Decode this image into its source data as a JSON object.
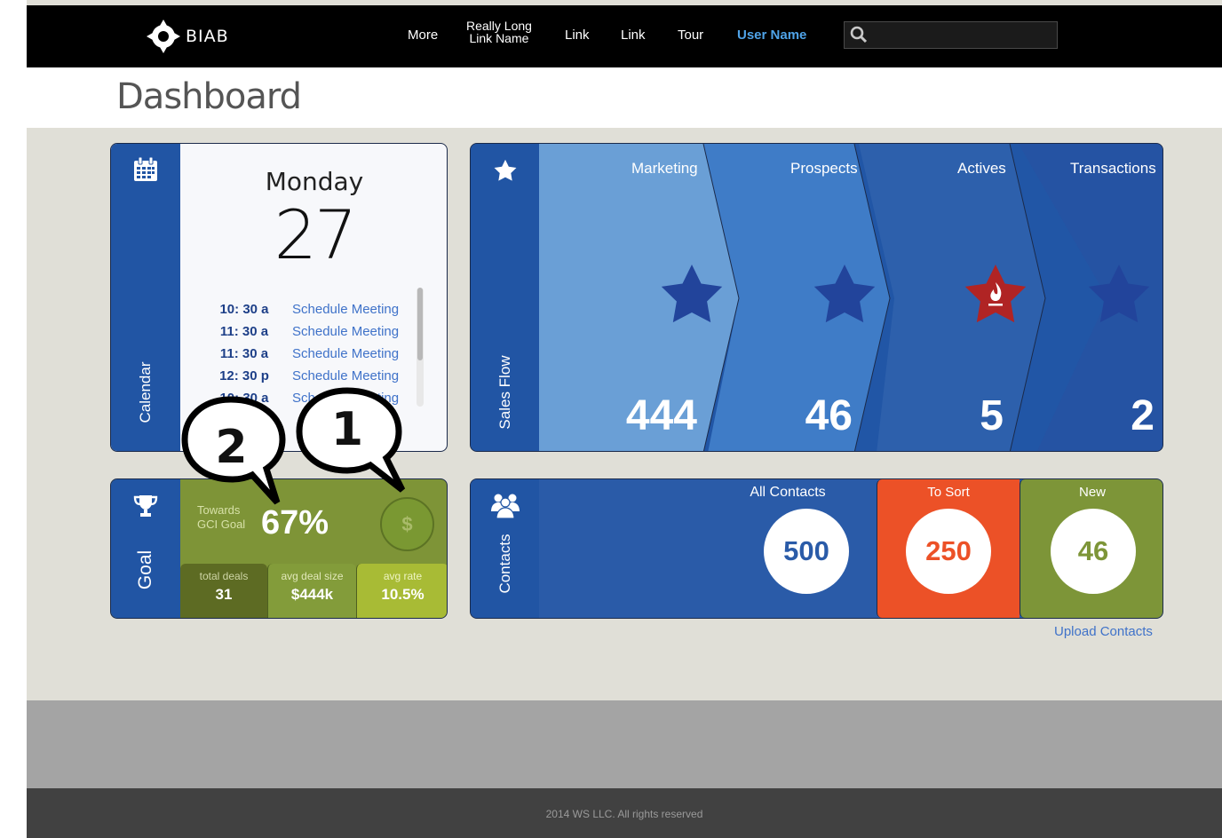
{
  "brand": {
    "name": "BIAB"
  },
  "nav": {
    "more": "More",
    "long_link_line1": "Really Long",
    "long_link_line2": "Link Name",
    "link1": "Link",
    "link2": "Link",
    "tour": "Tour",
    "user": "User Name"
  },
  "search": {
    "placeholder": "",
    "value": ""
  },
  "page": {
    "title": "Dashboard"
  },
  "calendar": {
    "label": "Calendar",
    "icon": "calendar-icon",
    "weekday": "Monday",
    "date": "27",
    "events": [
      {
        "time": "10: 30 a",
        "title": "Schedule Meeting"
      },
      {
        "time": "11: 30 a",
        "title": "Schedule Meeting"
      },
      {
        "time": "11: 30 a",
        "title": "Schedule Meeting"
      },
      {
        "time": "12: 30 p",
        "title": "Schedule Meeting"
      },
      {
        "time": "10: 30 a",
        "title": "Schedule Meeting"
      }
    ]
  },
  "sales_flow": {
    "label": "Sales Flow",
    "icon": "star-icon",
    "stages": [
      {
        "name": "Marketing",
        "count": "444",
        "color": "#6a9fd6"
      },
      {
        "name": "Prospects",
        "count": "46",
        "color": "#3f7cc7"
      },
      {
        "name": "Actives",
        "count": "5",
        "color": "#2d60ac"
      },
      {
        "name": "Transactions",
        "count": "2",
        "color": "#2553a3"
      }
    ],
    "star_color": "#22449b",
    "active_star_color": "#b02424"
  },
  "goal": {
    "label": "Goal",
    "icon": "trophy-icon",
    "towards_line1": "Towards",
    "towards_line2": "GCI Goal",
    "percent": "67%",
    "dollar": "$",
    "metrics": [
      {
        "label": "total deals",
        "value": "31"
      },
      {
        "label": "avg deal size",
        "value": "$444k"
      },
      {
        "label": "avg rate",
        "value": "10.5%"
      }
    ]
  },
  "contacts": {
    "label": "Contacts",
    "icon": "people-icon",
    "segments": [
      {
        "title": "All Contacts",
        "value": "500",
        "color": "#2a5ba8"
      },
      {
        "title": "To Sort",
        "value": "250",
        "color": "#ec5127"
      },
      {
        "title": "New",
        "value": "46",
        "color": "#7d9538"
      }
    ],
    "upload": "Upload Contacts"
  },
  "callouts": [
    "2",
    "1"
  ],
  "footer": {
    "copyright": "2014 WS LLC. All rights reserved"
  }
}
